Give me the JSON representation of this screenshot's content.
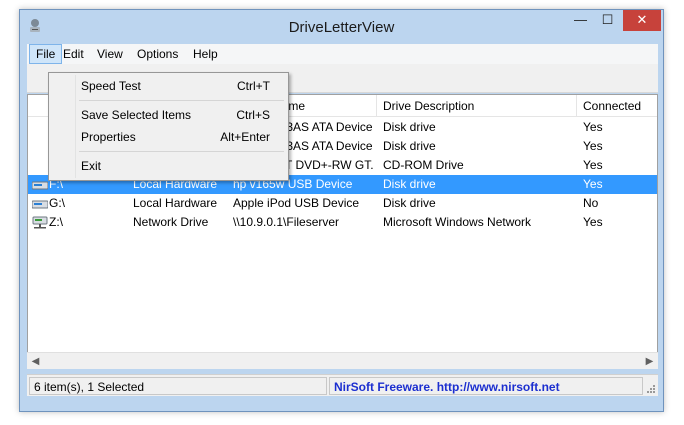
{
  "window": {
    "title": "DriveLetterView",
    "close_glyph": "✕",
    "minimize_glyph": "—",
    "maximize_glyph": "☐"
  },
  "menubar": {
    "items": [
      {
        "label": "File"
      },
      {
        "label": "Edit"
      },
      {
        "label": "View"
      },
      {
        "label": "Options"
      },
      {
        "label": "Help"
      }
    ]
  },
  "file_menu": {
    "items": [
      {
        "label": "Speed Test",
        "shortcut": "Ctrl+T"
      },
      {
        "label": "Save Selected Items",
        "shortcut": "Ctrl+S"
      },
      {
        "label": "Properties",
        "shortcut": "Alt+Enter"
      },
      {
        "label": "Exit",
        "shortcut": ""
      }
    ]
  },
  "table": {
    "columns": [
      "Name",
      "Drive Description",
      "Connected"
    ],
    "rows": [
      {
        "drive": "",
        "type": "",
        "name": "413AS ATA Device",
        "description": "Disk drive",
        "connected": "Yes",
        "icon": "hard-drive-icon",
        "selected": false
      },
      {
        "drive": "",
        "type": "",
        "name": "413AS ATA Device",
        "description": "Disk drive",
        "connected": "Yes",
        "icon": "hard-drive-icon",
        "selected": false
      },
      {
        "drive": "",
        "type": "",
        "name": "-ST DVD+-RW GT...",
        "description": "CD-ROM Drive",
        "connected": "Yes",
        "icon": "cdrom-icon",
        "selected": false
      },
      {
        "drive": "F:\\",
        "type": "Local Hardware",
        "name": "hp v165w USB Device",
        "description": "Disk drive",
        "connected": "Yes",
        "icon": "usb-drive-icon",
        "selected": true
      },
      {
        "drive": "G:\\",
        "type": "Local Hardware",
        "name": "Apple iPod USB Device",
        "description": "Disk drive",
        "connected": "No",
        "icon": "usb-drive-icon",
        "selected": false
      },
      {
        "drive": "Z:\\",
        "type": "Network Drive",
        "name": "\\\\10.9.0.1\\Fileserver",
        "description": "Microsoft Windows Network",
        "connected": "Yes",
        "icon": "network-drive-icon",
        "selected": false
      }
    ]
  },
  "statusbar": {
    "count_text": "6 item(s), 1 Selected",
    "link_text": "NirSoft Freeware.  http://www.nirsoft.net"
  },
  "colors": {
    "selection": "#3399ff",
    "close_button": "#c7423b",
    "link": "#1c2fd0",
    "window_frame": "#bcd5ef"
  }
}
